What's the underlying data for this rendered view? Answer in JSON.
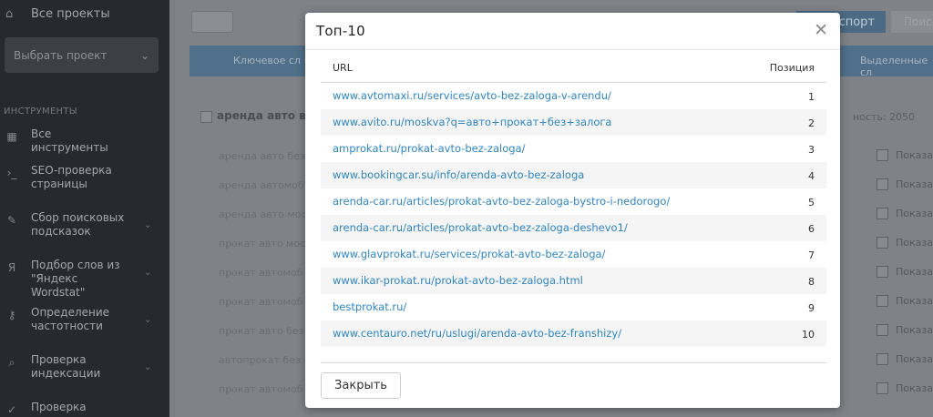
{
  "sidebar": {
    "top_item": {
      "icon": "home-icon",
      "label": "Все проекты"
    },
    "project_select": {
      "placeholder": "Выбрать проект"
    },
    "section_title": "ИНСТРУМЕНТЫ",
    "items": [
      {
        "icon": "grid-icon",
        "label": "Все инструменты",
        "chevron": false
      },
      {
        "icon": "terminal-icon",
        "label": "SEO-проверка страницы",
        "chevron": false
      },
      {
        "icon": "edit-icon",
        "label": "Сбор поисковых подсказок",
        "chevron": true
      },
      {
        "icon": "yandex-icon",
        "label": "Подбор слов из \"Яндекс Wordstat\"",
        "chevron": true
      },
      {
        "icon": "key-icon",
        "label": "Определение частотности",
        "chevron": true
      },
      {
        "icon": "search-icon",
        "label": "Проверка индексации",
        "chevron": true
      },
      {
        "icon": "check-icon",
        "label": "Проверка",
        "chevron": false
      }
    ]
  },
  "background": {
    "export_label": "спорт",
    "export2_label": "Поиск",
    "header_col1": "Ключевое сл",
    "header_col2": "Выделенные сл",
    "group_title": "аренда авто в",
    "group_right": "ность: 2050",
    "rows": [
      "аренда авто без",
      "аренда автомоб",
      "аренда авто мос",
      "прокат авто мос",
      "прокат автомоб",
      "прокат автомоб",
      "прокат авто без",
      "автопрокат без",
      "прокат автомоб"
    ],
    "row_action": "Показать"
  },
  "modal": {
    "title": "Топ-10",
    "close_icon": "close-icon",
    "columns": {
      "url": "URL",
      "position": "Позиция"
    },
    "rows": [
      {
        "url": "www.avtomaxi.ru/services/avto-bez-zaloga-v-arendu/",
        "position": "1"
      },
      {
        "url": "www.avito.ru/moskva?q=авто+прокат+без+залога",
        "position": "2"
      },
      {
        "url": "amprokat.ru/prokat-avto-bez-zaloga/",
        "position": "3"
      },
      {
        "url": "www.bookingcar.su/info/arenda-avto-bez-zaloga",
        "position": "4"
      },
      {
        "url": "arenda-car.ru/articles/prokat-avto-bez-zaloga-bystro-i-nedorogo/",
        "position": "5"
      },
      {
        "url": "arenda-car.ru/articles/prokat-avto-bez-zaloga-deshevo1/",
        "position": "6"
      },
      {
        "url": "www.glavprokat.ru/services/prokat-avto-bez-zaloga/",
        "position": "7"
      },
      {
        "url": "www.ikar-prokat.ru/prokat-avto-bez-zaloga.html",
        "position": "8"
      },
      {
        "url": "bestprokat.ru/",
        "position": "9"
      },
      {
        "url": "www.centauro.net/ru/uslugi/arenda-avto-bez-franshizy/",
        "position": "10"
      }
    ],
    "close_button_label": "Закрыть"
  },
  "colors": {
    "link": "#2f85c6",
    "overlay": "#7f8287",
    "sidebar": "#26292e",
    "row_alt": "#f5f5f5"
  }
}
